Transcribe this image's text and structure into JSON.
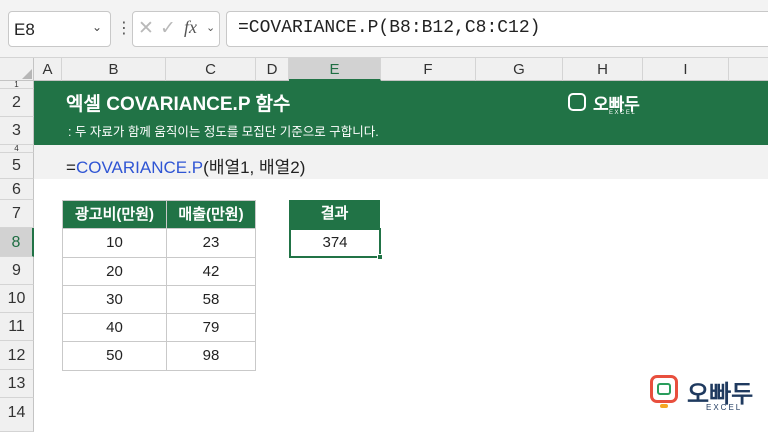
{
  "formula_bar": {
    "name_box": "E8",
    "fx_label": "fx",
    "formula": "=COVARIANCE.P(B8:B12,C8:C12)"
  },
  "columns": [
    "A",
    "B",
    "C",
    "D",
    "E",
    "F",
    "G",
    "H",
    "I"
  ],
  "selected_column": "E",
  "rows": [
    "1",
    "2",
    "3",
    "4",
    "5",
    "6",
    "7",
    "8",
    "9",
    "10",
    "11",
    "12",
    "13",
    "14"
  ],
  "selected_row": "8",
  "banner": {
    "title": "엑셀 COVARIANCE.P 함수",
    "subtitle": ": 두 자료가 함께 움직이는 정도를 모집단 기준으로 구합니다.",
    "logo_text": "오빠두",
    "logo_sub": "EXCEL"
  },
  "syntax": {
    "prefix": "=",
    "function": "COVARIANCE.P",
    "args": "(배열1, 배열2)"
  },
  "table": {
    "headers": [
      "광고비(만원)",
      "매출(만원)"
    ],
    "rows": [
      [
        "10",
        "23"
      ],
      [
        "20",
        "42"
      ],
      [
        "30",
        "58"
      ],
      [
        "40",
        "79"
      ],
      [
        "50",
        "98"
      ]
    ]
  },
  "result": {
    "header": "결과",
    "value": "374"
  },
  "brand": {
    "name": "오빠두",
    "sub": "EXCEL",
    "colors": {
      "green": "#217346",
      "accent_red": "#e84f3d",
      "accent_orange": "#f5a623"
    }
  },
  "icons": [
    "chevron-down-icon",
    "more-vertical-icon",
    "cancel-icon",
    "enter-check-icon",
    "function-icon"
  ]
}
